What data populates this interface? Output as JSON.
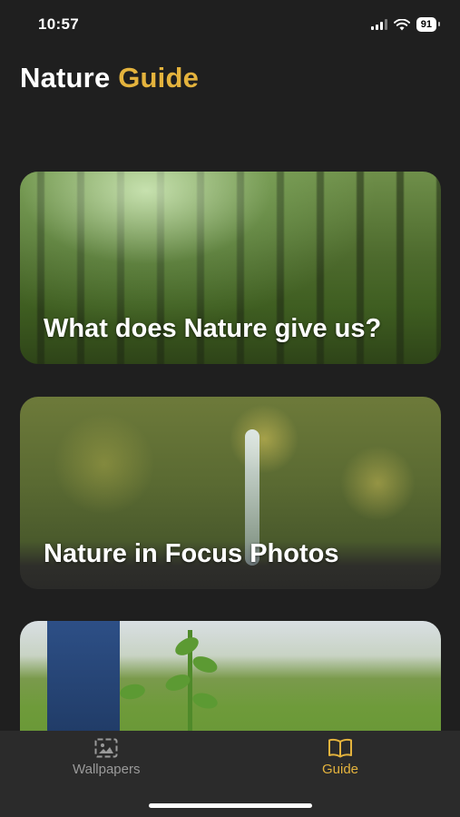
{
  "status_bar": {
    "time": "10:57",
    "battery": "91"
  },
  "header": {
    "title_part1": "Nature",
    "title_part2": "Guide"
  },
  "cards": [
    {
      "label": "What does Nature give us?"
    },
    {
      "label": "Nature in Focus Photos"
    },
    {
      "label": ""
    }
  ],
  "tab_bar": {
    "tabs": [
      {
        "label": "Wallpapers",
        "icon": "wallpaper-image-icon",
        "active": false
      },
      {
        "label": "Guide",
        "icon": "book-icon",
        "active": true
      }
    ]
  },
  "colors": {
    "accent": "#e4b33d",
    "background": "#1f1f1f",
    "tab_bar": "#2b2b2b"
  }
}
